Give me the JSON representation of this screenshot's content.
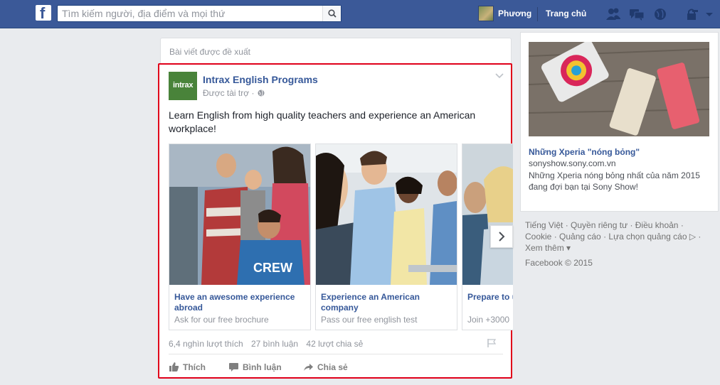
{
  "topbar": {
    "search_placeholder": "Tìm kiếm người, địa điểm và mọi thứ",
    "profile_name": "Phương",
    "home_label": "Trang chủ"
  },
  "feed": {
    "suggested_header": "Bài viết được đề xuất",
    "post": {
      "page_name": "Intrax English Programs",
      "page_logo_text": "intrax",
      "sponsored_label": "Được tài trợ",
      "text": "Learn English from high quality teachers and experience an American workplace!",
      "carousel": [
        {
          "title": "Have an awesome experience abroad",
          "subtitle": "Ask for our free brochure"
        },
        {
          "title": "Experience an American company",
          "subtitle": "Pass our free english test"
        },
        {
          "title": "Prepare to university",
          "subtitle": "Join +3000"
        }
      ],
      "stats": {
        "likes": "6,4 nghìn lượt thích",
        "comments": "27 bình luận",
        "shares": "42 lượt chia sẻ"
      },
      "actions": {
        "like": "Thích",
        "comment": "Bình luận",
        "share": "Chia sẻ"
      }
    }
  },
  "sidebar": {
    "ad": {
      "title": "Những Xperia \"nóng bỏng\"",
      "url": "sonyshow.sony.com.vn",
      "description": "Những Xperia nóng bỏng nhất của năm 2015 đang đợi bạn tại Sony Show!"
    },
    "footer": {
      "links_line1": "Tiếng Việt · Quyền riêng tư · Điều khoản ·",
      "links_line2": "Cookie · Quảng cáo · Lựa chọn quảng cáo ▷ ·",
      "links_line3": "Xem thêm ▾",
      "copyright": "Facebook © 2015"
    }
  },
  "colors": {
    "brand": "#3b5998",
    "link": "#365899",
    "highlight_border": "#e0001a"
  }
}
